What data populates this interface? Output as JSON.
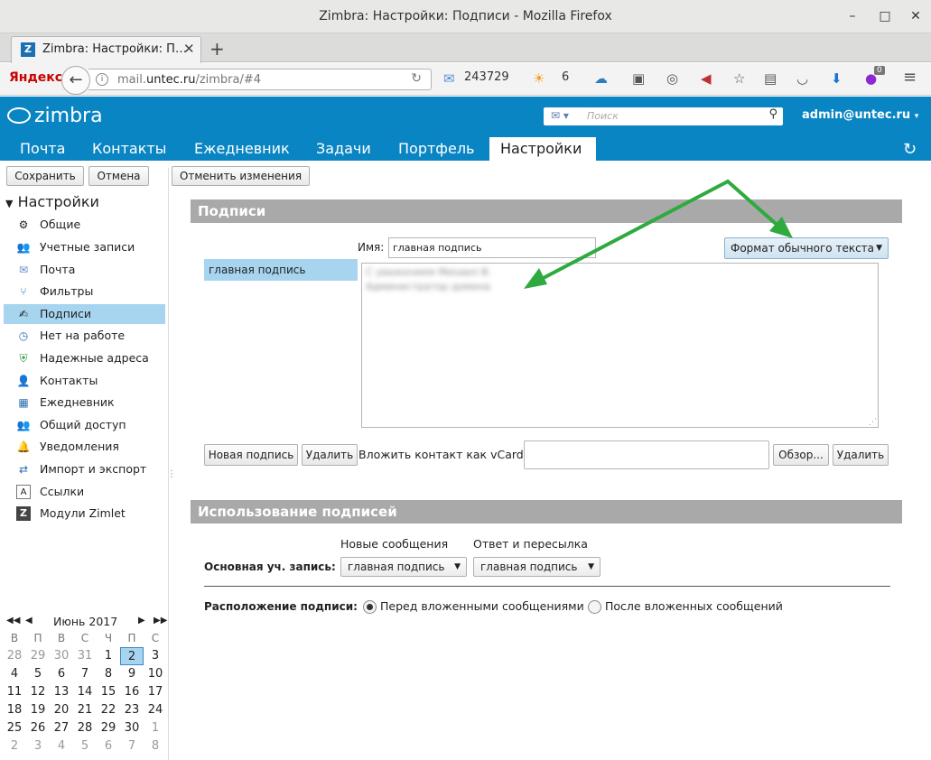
{
  "window": {
    "title": "Zimbra: Настройки: Подписи - Mozilla Firefox",
    "minimize": "–",
    "maximize": "□",
    "close": "✕"
  },
  "browser": {
    "tab_title": "Zimbra: Настройки: П…",
    "tab_close": "✕",
    "new_tab": "+",
    "yandex": "Яндекс",
    "url_prefix": "mail.",
    "url_domain": "untec.ru",
    "url_path": "/zimbra/#4",
    "mail_count": "243729",
    "weather_temp": "6",
    "ext_badge": "0"
  },
  "zimbra": {
    "logo": "zimbra",
    "search_placeholder": "Поиск",
    "user": "admin@untec.ru",
    "tabs": [
      "Почта",
      "Контакты",
      "Ежедневник",
      "Задачи",
      "Портфель",
      "Настройки"
    ],
    "active_tab": "Настройки"
  },
  "toolbar": {
    "save": "Сохранить",
    "cancel": "Отмена",
    "revert": "Отменить изменения"
  },
  "sidebar": {
    "header": "Настройки",
    "items": [
      "Общие",
      "Учетные записи",
      "Почта",
      "Фильтры",
      "Подписи",
      "Нет на работе",
      "Надежные адреса",
      "Контакты",
      "Ежедневник",
      "Общий доступ",
      "Уведомления",
      "Импорт и экспорт",
      "Ссылки",
      "Модули Zimlet"
    ],
    "selected": "Подписи"
  },
  "calendar": {
    "month": "Июнь 2017",
    "weekdays": [
      "В",
      "П",
      "В",
      "С",
      "Ч",
      "П",
      "С"
    ],
    "weeks": [
      [
        "28",
        "29",
        "30",
        "31",
        "1",
        "2",
        "3"
      ],
      [
        "4",
        "5",
        "6",
        "7",
        "8",
        "9",
        "10"
      ],
      [
        "11",
        "12",
        "13",
        "14",
        "15",
        "16",
        "17"
      ],
      [
        "18",
        "19",
        "20",
        "21",
        "22",
        "23",
        "24"
      ],
      [
        "25",
        "26",
        "27",
        "28",
        "29",
        "30",
        "1"
      ],
      [
        "2",
        "3",
        "4",
        "5",
        "6",
        "7",
        "8"
      ]
    ],
    "today": "2"
  },
  "signatures": {
    "section_title": "Подписи",
    "name_label": "Имя:",
    "name_value": "главная подпись",
    "format_button": "Формат обычного текста",
    "list": [
      "главная подпись"
    ],
    "body_line1": "С уважением Михаил В.",
    "body_line2": "Администратор домена",
    "new_button": "Новая подпись",
    "delete_button": "Удалить",
    "vcard_label": "Вложить контакт как vCard:",
    "browse_button": "Обзор...",
    "vcard_delete_button": "Удалить"
  },
  "usage": {
    "section_title": "Использование подписей",
    "col_new": "Новые сообщения",
    "col_reply": "Ответ и пересылка",
    "account_label": "Основная уч. запись:",
    "new_value": "главная подпись",
    "reply_value": "главная подпись",
    "placement_label": "Расположение подписи:",
    "placement_before": "Перед вложенными сообщениями",
    "placement_after": "После вложенных сообщений",
    "placement_selected": "before"
  },
  "colors": {
    "zimbra_blue": "#0a85c3",
    "selection": "#a7d4ef",
    "arrow": "#2eaa3e"
  }
}
